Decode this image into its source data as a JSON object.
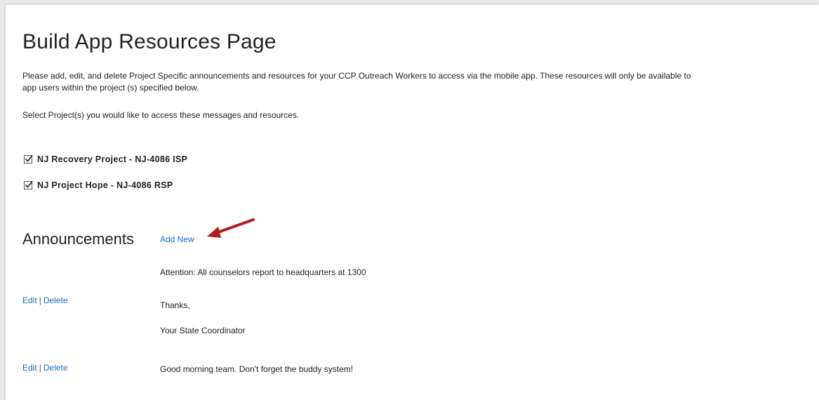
{
  "page": {
    "title": "Build App Resources Page",
    "description_line1": "Please add, edit, and delete Project Specific announcements and resources for your CCP Outreach Workers to access via the mobile app. These resources will only be available to",
    "description_line2": "app users within the project (s) specified below.",
    "select_prompt": "Select Project(s) you would like to access these messages and resources."
  },
  "projects": [
    {
      "label": "NJ Recovery Project - NJ-4086 ISP",
      "checked": true
    },
    {
      "label": "NJ Project Hope - NJ-4086 RSP",
      "checked": true
    }
  ],
  "announcements": {
    "heading": "Announcements",
    "add_new_label": "Add New",
    "annotation_arrow_color": "#b01c1c",
    "link_color": "#1a6fc0",
    "items": [
      {
        "edit_label": "Edit",
        "separator": "|",
        "delete_label": "Delete",
        "lines": [
          "Attention: All counselors report to headquarters at 1300",
          "Thanks,",
          "Your State Coordinator"
        ]
      },
      {
        "edit_label": "Edit",
        "separator": "|",
        "delete_label": "Delete",
        "lines": [
          "Good morning team. Don't forget the buddy system!"
        ]
      }
    ]
  }
}
